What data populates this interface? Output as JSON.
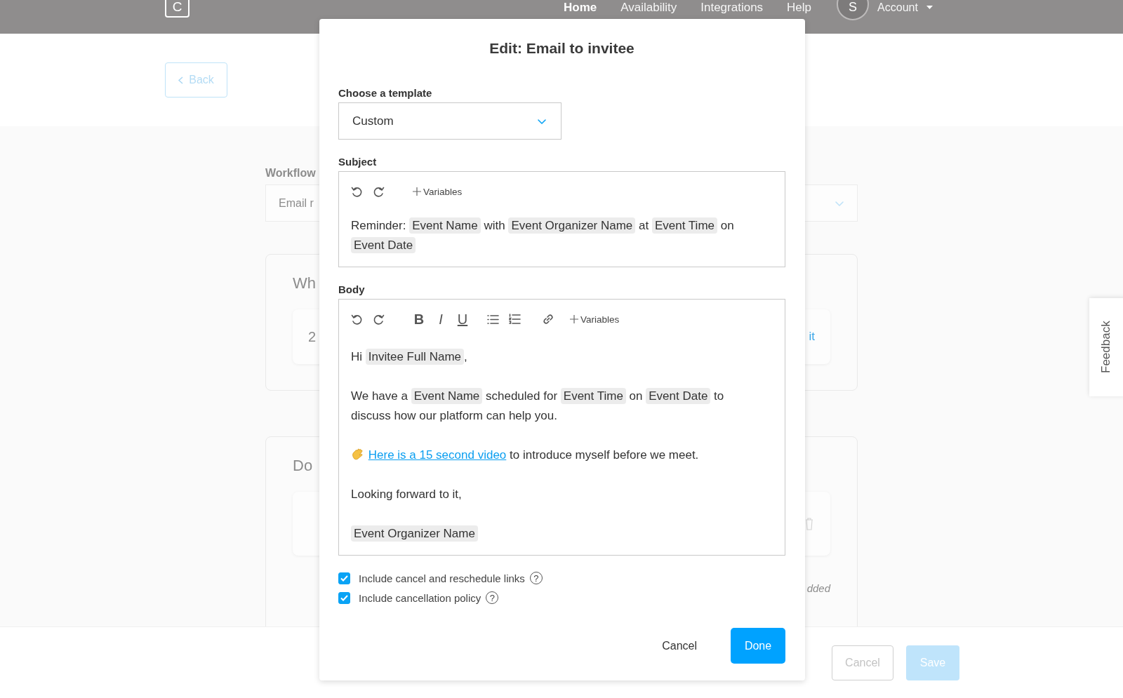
{
  "header": {
    "logo_letter": "C",
    "nav": [
      {
        "label": "Home",
        "selected": true
      },
      {
        "label": "Availability",
        "selected": false
      },
      {
        "label": "Integrations",
        "selected": false
      },
      {
        "label": "Help",
        "selected": false
      }
    ],
    "avatar_initial": "S",
    "account_label": "Account"
  },
  "page": {
    "back_button": "Back",
    "workflow_label": "Workflow",
    "workflow_select": "Email r",
    "card_1": {
      "heading": "Wh",
      "row_text": "2",
      "row_action": "it"
    },
    "card_2": {
      "heading": "Do",
      "note": "dded"
    },
    "footer_buttons": [
      {
        "label": "Cancel",
        "kind": "secondary"
      },
      {
        "label": "Save",
        "kind": "primary"
      }
    ]
  },
  "feedback_tab": "Feedback",
  "modal": {
    "title": "Edit: Email to invitee",
    "template_label": "Choose a template",
    "template_value": "Custom",
    "subject": {
      "label": "Subject",
      "toolbar": [
        {
          "kind": "undo"
        },
        {
          "kind": "redo"
        },
        {
          "kind": "variables",
          "label": "Variables"
        }
      ],
      "paragraphs": [
        [
          {
            "kind": "text",
            "text": "Reminder:"
          },
          {
            "kind": "variable",
            "text": "Event Name"
          },
          {
            "kind": "text",
            "text": "with"
          },
          {
            "kind": "variable",
            "text": "Event Organizer Name"
          },
          {
            "kind": "text",
            "text": "at"
          },
          {
            "kind": "variable",
            "text": "Event Time"
          },
          {
            "kind": "text",
            "text": "on"
          },
          {
            "kind": "variable",
            "text": "Event Date"
          }
        ]
      ]
    },
    "body": {
      "label": "Body",
      "toolbar": [
        {
          "kind": "undo"
        },
        {
          "kind": "redo"
        },
        {
          "kind": "bold",
          "label": "B"
        },
        {
          "kind": "italic",
          "label": "I"
        },
        {
          "kind": "underline",
          "label": "U"
        },
        {
          "kind": "bullet_list"
        },
        {
          "kind": "numbered_list"
        },
        {
          "kind": "link"
        },
        {
          "kind": "variables",
          "label": "Variables"
        }
      ],
      "paragraphs": [
        [
          {
            "kind": "text",
            "text": "Hi"
          },
          {
            "kind": "variable",
            "text": "Invitee Full Name"
          },
          {
            "kind": "punct",
            "text": ","
          }
        ],
        [
          {
            "kind": "text",
            "text": "We have a"
          },
          {
            "kind": "variable",
            "text": "Event Name"
          },
          {
            "kind": "text",
            "text": "scheduled for"
          },
          {
            "kind": "variable",
            "text": "Event Time"
          },
          {
            "kind": "text",
            "text": "on"
          },
          {
            "kind": "variable",
            "text": "Event Date"
          },
          {
            "kind": "text",
            "text": "to"
          },
          {
            "kind": "text",
            "text": "discuss how our platform can help you."
          }
        ],
        [
          {
            "kind": "wave_icon"
          },
          {
            "kind": "link",
            "text": "Here is a 15 second video"
          },
          {
            "kind": "text",
            "text": "to introduce myself before we meet."
          }
        ],
        [
          {
            "kind": "text",
            "text": "Looking forward to it,"
          }
        ],
        [
          {
            "kind": "variable",
            "text": "Event Organizer Name"
          }
        ]
      ]
    },
    "options": [
      {
        "label": "Include cancel and reschedule links",
        "checked": true,
        "help": "?"
      },
      {
        "label": "Include cancellation policy",
        "checked": true,
        "help": "?"
      }
    ],
    "buttons": [
      {
        "label": "Cancel",
        "kind": "secondary"
      },
      {
        "label": "Done",
        "kind": "primary"
      }
    ]
  }
}
